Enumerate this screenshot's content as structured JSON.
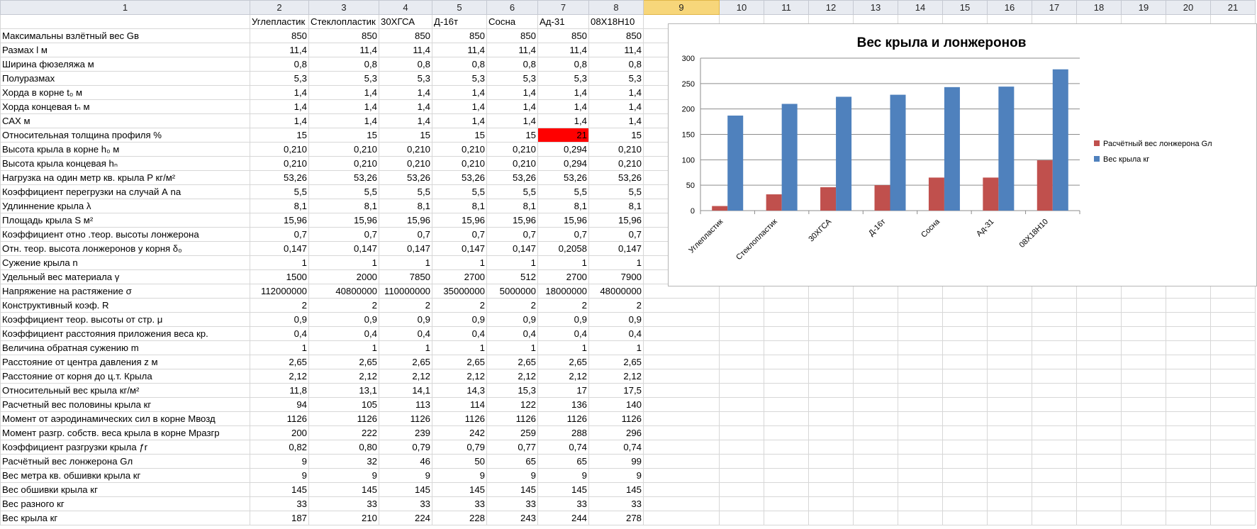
{
  "columns": [
    "1",
    "2",
    "3",
    "4",
    "5",
    "6",
    "7",
    "8",
    "9",
    "10",
    "11",
    "12",
    "13",
    "14",
    "15",
    "16",
    "17",
    "18",
    "19",
    "20",
    "21"
  ],
  "selected_column": "9",
  "materials": [
    "Углепластик",
    "Стеклопластик",
    "30ХГСА",
    "Д-16т",
    "Сосна",
    "Ад-31",
    "08Х18Н10"
  ],
  "rows": [
    {
      "label": "Максимальны взлётный вес Gв",
      "values": [
        "850",
        "850",
        "850",
        "850",
        "850",
        "850",
        "850"
      ]
    },
    {
      "label": "Размах l м",
      "values": [
        "11,4",
        "11,4",
        "11,4",
        "11,4",
        "11,4",
        "11,4",
        "11,4"
      ]
    },
    {
      "label": "Ширина фюзеляжа м",
      "values": [
        "0,8",
        "0,8",
        "0,8",
        "0,8",
        "0,8",
        "0,8",
        "0,8"
      ]
    },
    {
      "label": "Полуразмах",
      "values": [
        "5,3",
        "5,3",
        "5,3",
        "5,3",
        "5,3",
        "5,3",
        "5,3"
      ]
    },
    {
      "label": "Хорда в корне t₀ м",
      "values": [
        "1,4",
        "1,4",
        "1,4",
        "1,4",
        "1,4",
        "1,4",
        "1,4"
      ]
    },
    {
      "label": "Хорда концевая tₙ м",
      "values": [
        "1,4",
        "1,4",
        "1,4",
        "1,4",
        "1,4",
        "1,4",
        "1,4"
      ]
    },
    {
      "label": "САХ м",
      "values": [
        "1,4",
        "1,4",
        "1,4",
        "1,4",
        "1,4",
        "1,4",
        "1,4"
      ]
    },
    {
      "label": "Относительная толщина профиля %",
      "values": [
        "15",
        "15",
        "15",
        "15",
        "15",
        "21",
        "15"
      ],
      "highlight": 5
    },
    {
      "label": "Высота крыла в корне h₀ м",
      "values": [
        "0,210",
        "0,210",
        "0,210",
        "0,210",
        "0,210",
        "0,294",
        "0,210"
      ]
    },
    {
      "label": "Высота крыла концевая hₙ",
      "values": [
        "0,210",
        "0,210",
        "0,210",
        "0,210",
        "0,210",
        "0,294",
        "0,210"
      ]
    },
    {
      "label": "Нагрузка на один метр кв. крыла P кг/м²",
      "values": [
        "53,26",
        "53,26",
        "53,26",
        "53,26",
        "53,26",
        "53,26",
        "53,26"
      ]
    },
    {
      "label": "Коэффициент перегрузки на случай А nа",
      "values": [
        "5,5",
        "5,5",
        "5,5",
        "5,5",
        "5,5",
        "5,5",
        "5,5"
      ]
    },
    {
      "label": "Удлиннение крыла λ",
      "values": [
        "8,1",
        "8,1",
        "8,1",
        "8,1",
        "8,1",
        "8,1",
        "8,1"
      ]
    },
    {
      "label": "Площадь крыла S м²",
      "values": [
        "15,96",
        "15,96",
        "15,96",
        "15,96",
        "15,96",
        "15,96",
        "15,96"
      ]
    },
    {
      "label": "Коэффициент отно .теор. высоты лонжерона",
      "values": [
        "0,7",
        "0,7",
        "0,7",
        "0,7",
        "0,7",
        "0,7",
        "0,7"
      ]
    },
    {
      "label": "Отн. теор. высота лонжеронов у корня δ₀",
      "values": [
        "0,147",
        "0,147",
        "0,147",
        "0,147",
        "0,147",
        "0,2058",
        "0,147"
      ]
    },
    {
      "label": "Сужение крыла n",
      "values": [
        "1",
        "1",
        "1",
        "1",
        "1",
        "1",
        "1"
      ]
    },
    {
      "label": "Удельный вес материала γ",
      "values": [
        "1500",
        "2000",
        "7850",
        "2700",
        "512",
        "2700",
        "7900"
      ]
    },
    {
      "label": "Напряжение на растяжение σ",
      "values": [
        "112000000",
        "40800000",
        "110000000",
        "35000000",
        "5000000",
        "18000000",
        "48000000"
      ]
    },
    {
      "label": "Конструктивный коэф. R",
      "values": [
        "2",
        "2",
        "2",
        "2",
        "2",
        "2",
        "2"
      ]
    },
    {
      "label": "Коэффициент теор.  высоты  от стр. μ",
      "values": [
        "0,9",
        "0,9",
        "0,9",
        "0,9",
        "0,9",
        "0,9",
        "0,9"
      ]
    },
    {
      "label": "Коэффициент расстояния приложения веса кр.",
      "values": [
        "0,4",
        "0,4",
        "0,4",
        "0,4",
        "0,4",
        "0,4",
        "0,4"
      ]
    },
    {
      "label": "Величина обратная сужению m",
      "values": [
        "1",
        "1",
        "1",
        "1",
        "1",
        "1",
        "1"
      ]
    },
    {
      "label": "Расстояние от центра давления z м",
      "values": [
        "2,65",
        "2,65",
        "2,65",
        "2,65",
        "2,65",
        "2,65",
        "2,65"
      ]
    },
    {
      "label": "Расстояние от корня до ц.т. Крыла",
      "values": [
        "2,12",
        "2,12",
        "2,12",
        "2,12",
        "2,12",
        "2,12",
        "2,12"
      ]
    },
    {
      "label": "Относительный вес крыла кг/м²",
      "values": [
        "11,8",
        "13,1",
        "14,1",
        "14,3",
        "15,3",
        "17",
        "17,5"
      ]
    },
    {
      "label": "Расчетный вес половины крыла кг",
      "values": [
        "94",
        "105",
        "113",
        "114",
        "122",
        "136",
        "140"
      ]
    },
    {
      "label": "Момент от аэродинамических сил в корне Mвозд",
      "values": [
        "1126",
        "1126",
        "1126",
        "1126",
        "1126",
        "1126",
        "1126"
      ]
    },
    {
      "label": "Момент разгр. собств. веса крыла в корне Mразгр",
      "values": [
        "200",
        "222",
        "239",
        "242",
        "259",
        "288",
        "296"
      ]
    },
    {
      "label": "Коэффициент разгрузки крыла ƒr",
      "values": [
        "0,82",
        "0,80",
        "0,79",
        "0,79",
        "0,77",
        "0,74",
        "0,74"
      ]
    },
    {
      "label": "Расчётный вес лонжерона Gл",
      "values": [
        "9",
        "32",
        "46",
        "50",
        "65",
        "65",
        "99"
      ]
    },
    {
      "label": "Вес метра кв. обшивки крыла кг",
      "values": [
        "9",
        "9",
        "9",
        "9",
        "9",
        "9",
        "9"
      ]
    },
    {
      "label": "Вес обшивки крыла кг",
      "values": [
        "145",
        "145",
        "145",
        "145",
        "145",
        "145",
        "145"
      ]
    },
    {
      "label": "Вес разного кг",
      "values": [
        "33",
        "33",
        "33",
        "33",
        "33",
        "33",
        "33"
      ]
    },
    {
      "label": "Вес крыла кг",
      "values": [
        "187",
        "210",
        "224",
        "228",
        "243",
        "244",
        "278"
      ]
    }
  ],
  "chart_data": {
    "type": "bar",
    "title": "Вес крыла и лонжеронов",
    "categories": [
      "Углепластик",
      "Стеклопластик",
      "30ХГСА",
      "Д-16т",
      "Сосна",
      "Ад-31",
      "08Х18Н10"
    ],
    "series": [
      {
        "name": "Расчётный вес лонжерона Gл",
        "color": "#c0504d",
        "values": [
          9,
          32,
          46,
          50,
          65,
          65,
          99
        ]
      },
      {
        "name": "Вес крыла кг",
        "color": "#4f81bd",
        "values": [
          187,
          210,
          224,
          228,
          243,
          244,
          278
        ]
      }
    ],
    "ylim": [
      0,
      300
    ],
    "yticks": [
      0,
      50,
      100,
      150,
      200,
      250,
      300
    ],
    "grid": true,
    "legend": "right"
  }
}
